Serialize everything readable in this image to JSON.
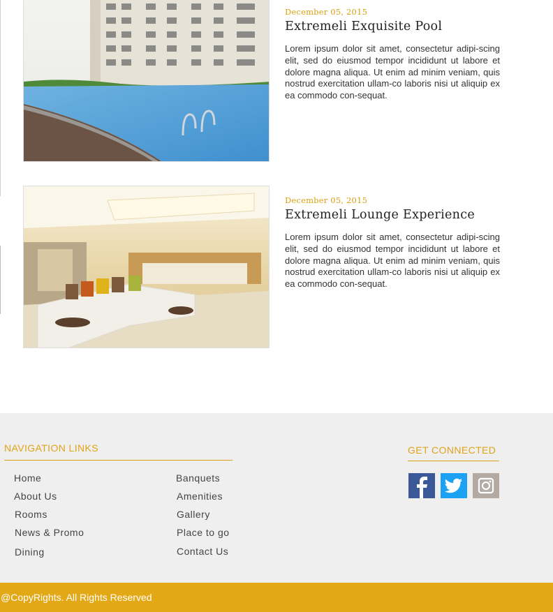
{
  "posts": [
    {
      "date": "December  05, 2015",
      "title": "Extremeli Exquisite Pool",
      "body": "Lorem ipsum dolor sit amet, consectetur adipi-scing elit, sed do eiusmod tempor incididunt ut labore et dolore magna aliqua. Ut enim ad minim veniam, quis nostrud exercitation ullam-co laboris nisi ut aliquip ex ea commodo con-sequat.",
      "image": "hotel-pool-photo"
    },
    {
      "date": "December  05, 2015",
      "title": "Extremeli Lounge Experience",
      "body": "Lorem ipsum dolor sit amet, consectetur adipi-scing elit, sed do eiusmod tempor incididunt ut labore et dolore magna aliqua. Ut enim ad minim veniam, quis nostrud exercitation ullam-co laboris nisi ut aliquip ex ea commodo con-sequat.",
      "image": "hotel-lounge-photo"
    }
  ],
  "footer": {
    "nav_heading": "NAVIGATION LINKS",
    "nav_left": [
      "Home",
      "About Us",
      "Rooms",
      "News & Promo",
      "Dining"
    ],
    "nav_right": [
      "Banquets",
      "Amenities",
      "Gallery",
      "Place to go",
      "Contact Us"
    ],
    "connect_heading": "GET CONNECTED",
    "social": [
      {
        "icon": "facebook-icon",
        "color": "#3b5998"
      },
      {
        "icon": "twitter-icon",
        "color": "#1da1f2"
      },
      {
        "icon": "instagram-icon",
        "color": "#b3aaa3"
      }
    ]
  },
  "copyright": "@CopyRights. All Rights Reserved",
  "colors": {
    "accent": "#e3a815",
    "footer_bg": "#efefef"
  }
}
